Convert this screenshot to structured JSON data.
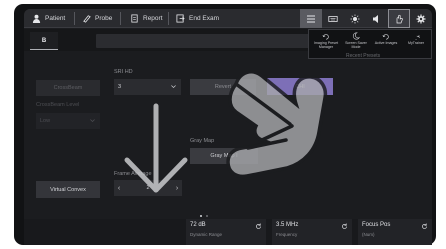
{
  "topbar": {
    "patient": "Patient",
    "probe": "Probe",
    "report": "Report",
    "end_exam": "End Exam"
  },
  "tab": {
    "label": "B"
  },
  "preset_panel": {
    "items": [
      {
        "label": "Imaging Preset Manager",
        "icon": "sliders-icon"
      },
      {
        "label": "Screen Saver Mode",
        "icon": "moon-icon"
      },
      {
        "label": "Active Images",
        "icon": "images-icon"
      },
      {
        "label": "MyTrainer",
        "icon": "trainer-icon"
      }
    ],
    "recent": "Recent Presets"
  },
  "left": {
    "crossbeam_btn": "CrossBeam",
    "crossbeam_level_label": "CrossBeam Level",
    "crossbeam_level_value": "Low",
    "virtual_convex": "Virtual Convex"
  },
  "center": {
    "sri_hd_label": "SRI HD",
    "sri_hd_value": "3",
    "revert": "Revert",
    "chi": "CHI",
    "gray_map_label": "Gray Map",
    "gray_map_value": "Gray Map I",
    "frame_average_label": "Frame Average",
    "frame_average_value": "2"
  },
  "bottom": [
    {
      "value": "72 dB",
      "label": "Dynamic Range"
    },
    {
      "value": "3.5 MHz",
      "label": "Frequency"
    },
    {
      "value": "Focus Pos",
      "label": "(Num)"
    }
  ],
  "colors": {
    "chi_accent": "#7d6fb7",
    "background": "#1b1c1f"
  }
}
